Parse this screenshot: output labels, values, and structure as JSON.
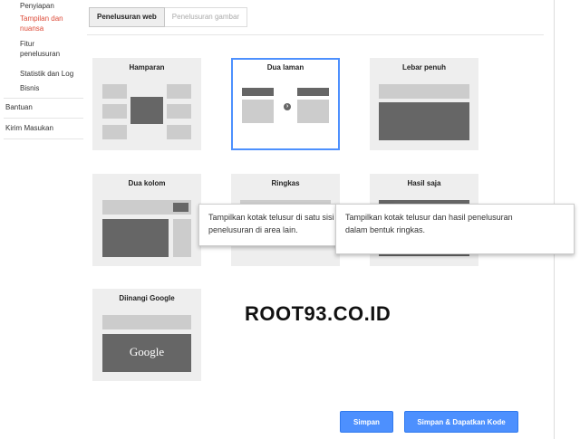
{
  "sidebar": {
    "items": [
      {
        "label": "Penyiapan"
      },
      {
        "label": "Tampilan dan nuansa",
        "line1": "Tampilan dan",
        "line2": "nuansa"
      },
      {
        "label": "Fitur penelusuran",
        "line1": "Fitur",
        "line2": "penelusuran"
      },
      {
        "label": "Statistik dan Log"
      },
      {
        "label": "Bisnis"
      }
    ],
    "help": "Bantuan",
    "feedback": "Kirim Masukan"
  },
  "tabs": [
    {
      "label": "Penelusuran web",
      "active": true
    },
    {
      "label": "Penelusuran gambar",
      "active": false
    }
  ],
  "layouts": [
    {
      "title": "Hamparan"
    },
    {
      "title": "Dua laman",
      "selected": true
    },
    {
      "title": "Lebar penuh"
    },
    {
      "title": "Dua kolom"
    },
    {
      "title": "Ringkas"
    },
    {
      "title": "Hasil saja"
    },
    {
      "title": "Diinangi Google",
      "logo_text": "Google"
    }
  ],
  "tooltips": [
    {
      "text": "Tampilkan kotak telusur di satu sisi dan hasil penelusuran di area lain.",
      "line1": "Tampilkan kotak telusur di satu sisi dan hasil",
      "line2": "penelusuran di area lain."
    },
    {
      "text": "Tampilkan kotak telusur dan hasil penelusuran dalam bentuk ringkas.",
      "line1": "Tampilkan kotak telusur dan hasil penelusuran",
      "line2": "dalam bentuk ringkas."
    }
  ],
  "watermark": "ROOT93.CO.ID",
  "buttons": {
    "save": "Simpan",
    "save_get_code": "Simpan & Dapatkan Kode"
  },
  "colors": {
    "accent": "#4d90fe",
    "active_nav": "#dd4b39",
    "block_light": "#cccccc",
    "block_dark": "#666666",
    "card_bg": "#eeeeee"
  }
}
